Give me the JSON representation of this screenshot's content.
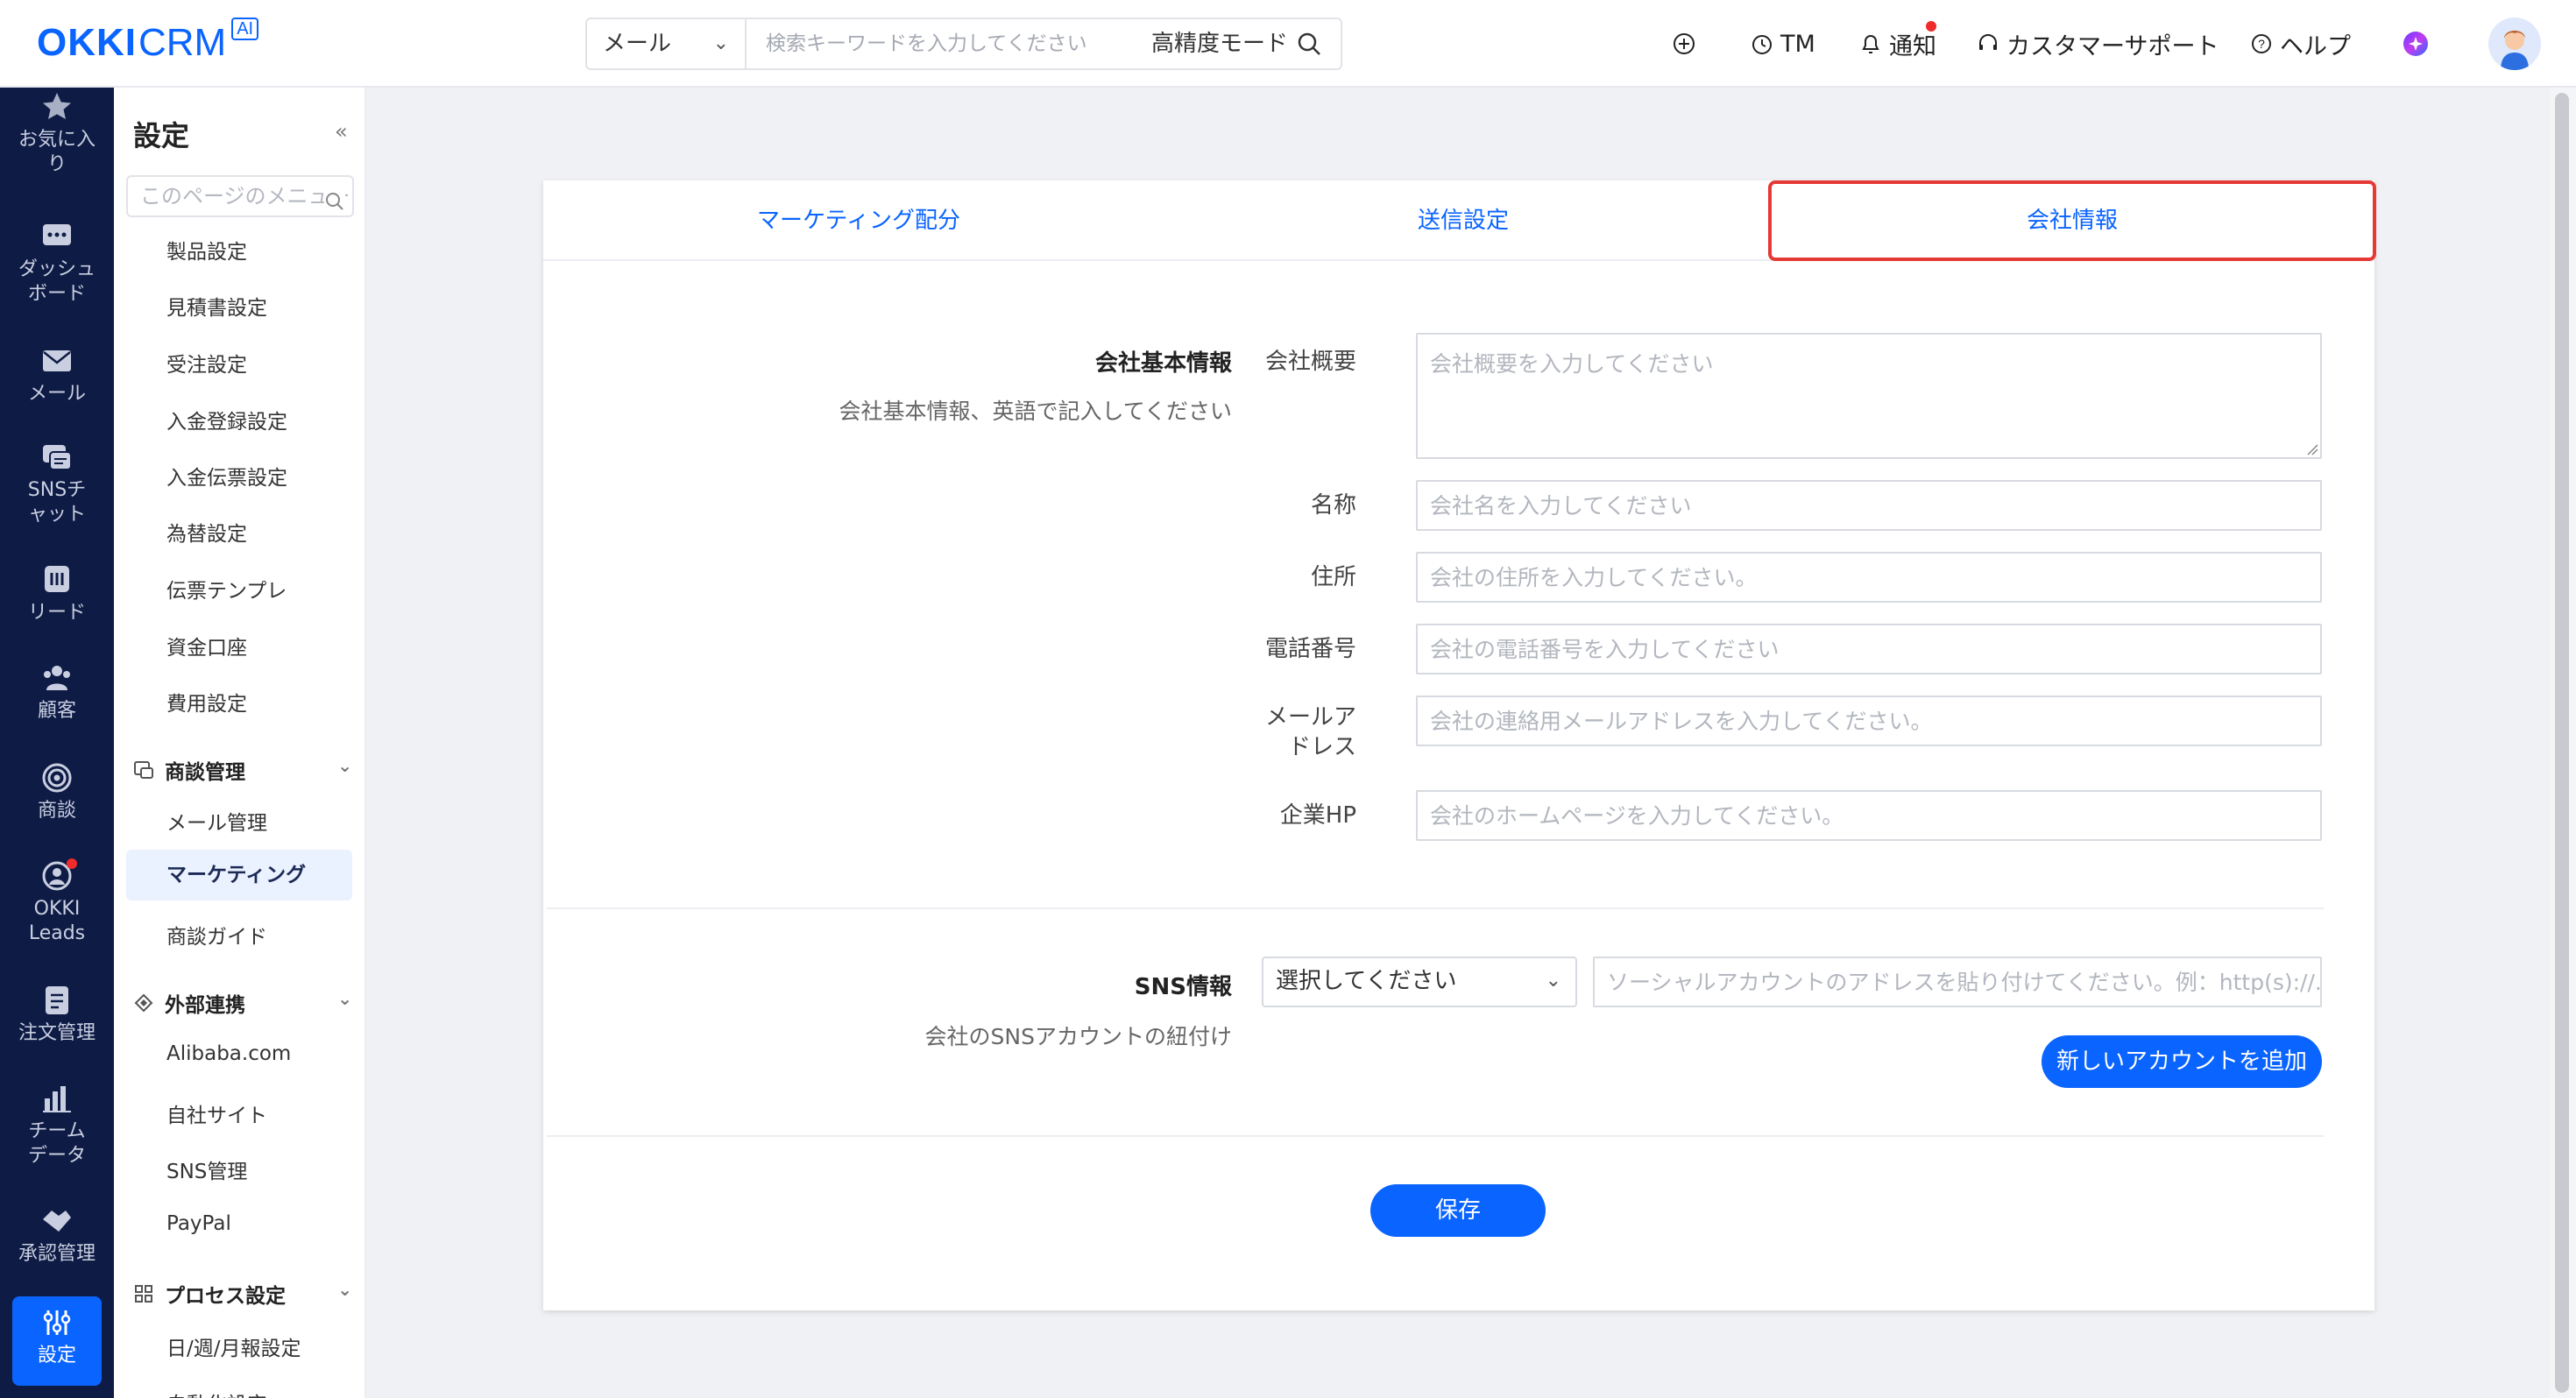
{
  "header": {
    "logo_text_1": "OKKI",
    "logo_text_2": "CRM",
    "logo_badge": "AI",
    "search_scope": "メール",
    "search_placeholder": "検索キーワードを入力してください",
    "search_mode": "高精度モード",
    "tm_label": "TM",
    "notify_label": "通知",
    "support_label": "カスタマーサポート",
    "help_label": "ヘルプ"
  },
  "rail": {
    "items": [
      {
        "label": "お気に入り",
        "icon": "star-icon"
      },
      {
        "label": "ダッシュボード",
        "icon": "dashboard-icon"
      },
      {
        "label": "メール",
        "icon": "mail-icon"
      },
      {
        "label": "SNSチャット",
        "icon": "chat-icon"
      },
      {
        "label": "リード",
        "icon": "leads-icon"
      },
      {
        "label": "顧客",
        "icon": "customers-icon"
      },
      {
        "label": "商談",
        "icon": "target-icon"
      },
      {
        "label": "OKKI Leads",
        "icon": "okki-leads-icon"
      },
      {
        "label": "注文管理",
        "icon": "order-icon"
      },
      {
        "label": "チームデータ",
        "icon": "bar-chart-icon"
      },
      {
        "label": "承認管理",
        "icon": "approve-icon"
      },
      {
        "label": "設定",
        "icon": "settings-icon"
      }
    ]
  },
  "sidebar": {
    "title": "設定",
    "collapse": "«",
    "search_placeholder": "このページのメニュー",
    "links_top": [
      "製品設定",
      "見積書設定",
      "受注設定",
      "入金登録設定",
      "入金伝票設定",
      "為替設定",
      "伝票テンプレ",
      "資金口座",
      "費用設定"
    ],
    "group_deal": "商談管理",
    "links_deal": [
      "メール管理",
      "マーケティング",
      "商談ガイド"
    ],
    "group_ext": "外部連携",
    "links_ext": [
      "Alibaba.com",
      "自社サイト",
      "SNS管理",
      "PayPal"
    ],
    "group_process": "プロセス設定",
    "links_process": [
      "日/週/月報設定",
      "自動化設定"
    ]
  },
  "tabs": [
    "マーケティング配分",
    "送信設定",
    "会社情報"
  ],
  "company": {
    "title": "会社基本情報",
    "desc": "会社基本情報、英語で記入してください",
    "fields": [
      {
        "label": "会社概要",
        "placeholder": "会社概要を入力してください"
      },
      {
        "label": "名称",
        "placeholder": "会社名を入力してください"
      },
      {
        "label": "住所",
        "placeholder": "会社の住所を入力してください。"
      },
      {
        "label": "電話番号",
        "placeholder": "会社の電話番号を入力してください"
      },
      {
        "label": "メールアドレス",
        "placeholder": "会社の連絡用メールアドレスを入力してください。"
      },
      {
        "label": "企業HP",
        "placeholder": "会社のホームページを入力してください。"
      }
    ]
  },
  "sns": {
    "title": "SNS情報",
    "desc": "会社のSNSアカウントの紐付け",
    "select_placeholder": "選択してください",
    "url_placeholder": "ソーシャルアカウントのアドレスを貼り付けてください。例：http(s)://...",
    "add_button": "新しいアカウントを追加"
  },
  "save_button": "保存",
  "colors": {
    "primary": "#0a64ff",
    "rail_bg": "#0e1b45",
    "highlight": "#e53935"
  }
}
